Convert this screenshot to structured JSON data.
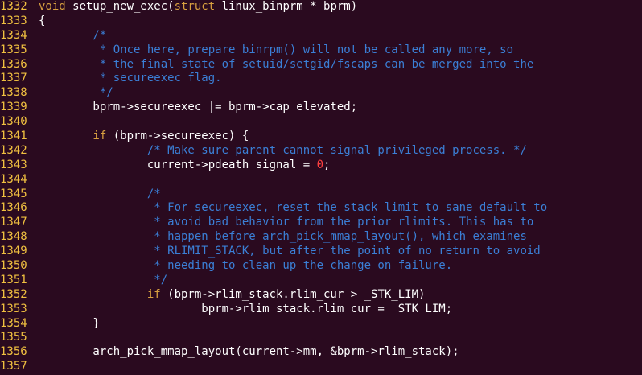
{
  "editor": {
    "lines": [
      {
        "n": "1332",
        "parts": [
          {
            "t": "kw",
            "s": "void"
          },
          {
            "t": "tx",
            "s": " setup_new_exec("
          },
          {
            "t": "kw",
            "s": "struct"
          },
          {
            "t": "tx",
            "s": " linux_binprm * bprm)"
          }
        ]
      },
      {
        "n": "1333",
        "parts": [
          {
            "t": "tx",
            "s": "{"
          }
        ]
      },
      {
        "n": "1334",
        "parts": [
          {
            "t": "cm",
            "s": "        /*"
          }
        ]
      },
      {
        "n": "1335",
        "parts": [
          {
            "t": "cm",
            "s": "         * Once here, prepare_binrpm() will not be called any more, so"
          }
        ]
      },
      {
        "n": "1336",
        "parts": [
          {
            "t": "cm",
            "s": "         * the final state of setuid/setgid/fscaps can be merged into the"
          }
        ]
      },
      {
        "n": "1337",
        "parts": [
          {
            "t": "cm",
            "s": "         * secureexec flag."
          }
        ]
      },
      {
        "n": "1338",
        "parts": [
          {
            "t": "cm",
            "s": "         */"
          }
        ]
      },
      {
        "n": "1339",
        "parts": [
          {
            "t": "tx",
            "s": "        bprm->secureexec |= bprm->cap_elevated;"
          }
        ]
      },
      {
        "n": "1340",
        "parts": [
          {
            "t": "tx",
            "s": ""
          }
        ]
      },
      {
        "n": "1341",
        "parts": [
          {
            "t": "kw",
            "s": "        if"
          },
          {
            "t": "tx",
            "s": " (bprm->secureexec) {"
          }
        ]
      },
      {
        "n": "1342",
        "parts": [
          {
            "t": "cm",
            "s": "                /* Make sure parent cannot signal privileged process. */"
          }
        ]
      },
      {
        "n": "1343",
        "parts": [
          {
            "t": "tx",
            "s": "                current->pdeath_signal = "
          },
          {
            "t": "num",
            "s": "0"
          },
          {
            "t": "tx",
            "s": ";"
          }
        ]
      },
      {
        "n": "1344",
        "parts": [
          {
            "t": "tx",
            "s": ""
          }
        ]
      },
      {
        "n": "1345",
        "parts": [
          {
            "t": "cm",
            "s": "                /*"
          }
        ]
      },
      {
        "n": "1346",
        "parts": [
          {
            "t": "cm",
            "s": "                 * For secureexec, reset the stack limit to sane default to"
          }
        ]
      },
      {
        "n": "1347",
        "parts": [
          {
            "t": "cm",
            "s": "                 * avoid bad behavior from the prior rlimits. This has to"
          }
        ]
      },
      {
        "n": "1348",
        "parts": [
          {
            "t": "cm",
            "s": "                 * happen before arch_pick_mmap_layout(), which examines"
          }
        ]
      },
      {
        "n": "1349",
        "parts": [
          {
            "t": "cm",
            "s": "                 * RLIMIT_STACK, but after the point of no return to avoid"
          }
        ]
      },
      {
        "n": "1350",
        "parts": [
          {
            "t": "cm",
            "s": "                 * needing to clean up the change on failure."
          }
        ]
      },
      {
        "n": "1351",
        "parts": [
          {
            "t": "cm",
            "s": "                 */"
          }
        ]
      },
      {
        "n": "1352",
        "parts": [
          {
            "t": "kw",
            "s": "                if"
          },
          {
            "t": "tx",
            "s": " (bprm->rlim_stack.rlim_cur > _STK_LIM)"
          }
        ]
      },
      {
        "n": "1353",
        "parts": [
          {
            "t": "tx",
            "s": "                        bprm->rlim_stack.rlim_cur = _STK_LIM;"
          }
        ]
      },
      {
        "n": "1354",
        "parts": [
          {
            "t": "tx",
            "s": "        }"
          }
        ]
      },
      {
        "n": "1355",
        "parts": [
          {
            "t": "tx",
            "s": ""
          }
        ]
      },
      {
        "n": "1356",
        "parts": [
          {
            "t": "tx",
            "s": "        arch_pick_mmap_layout(current->mm, &bprm->rlim_stack);"
          }
        ]
      },
      {
        "n": "1357",
        "parts": [
          {
            "t": "tx",
            "s": ""
          }
        ]
      }
    ]
  },
  "colors": {
    "background": "#2a0a1f",
    "line_number": "#f0c040",
    "keyword": "#d8a040",
    "comment": "#3b7fd6",
    "number": "#ff4040",
    "text": "#ffffff"
  }
}
